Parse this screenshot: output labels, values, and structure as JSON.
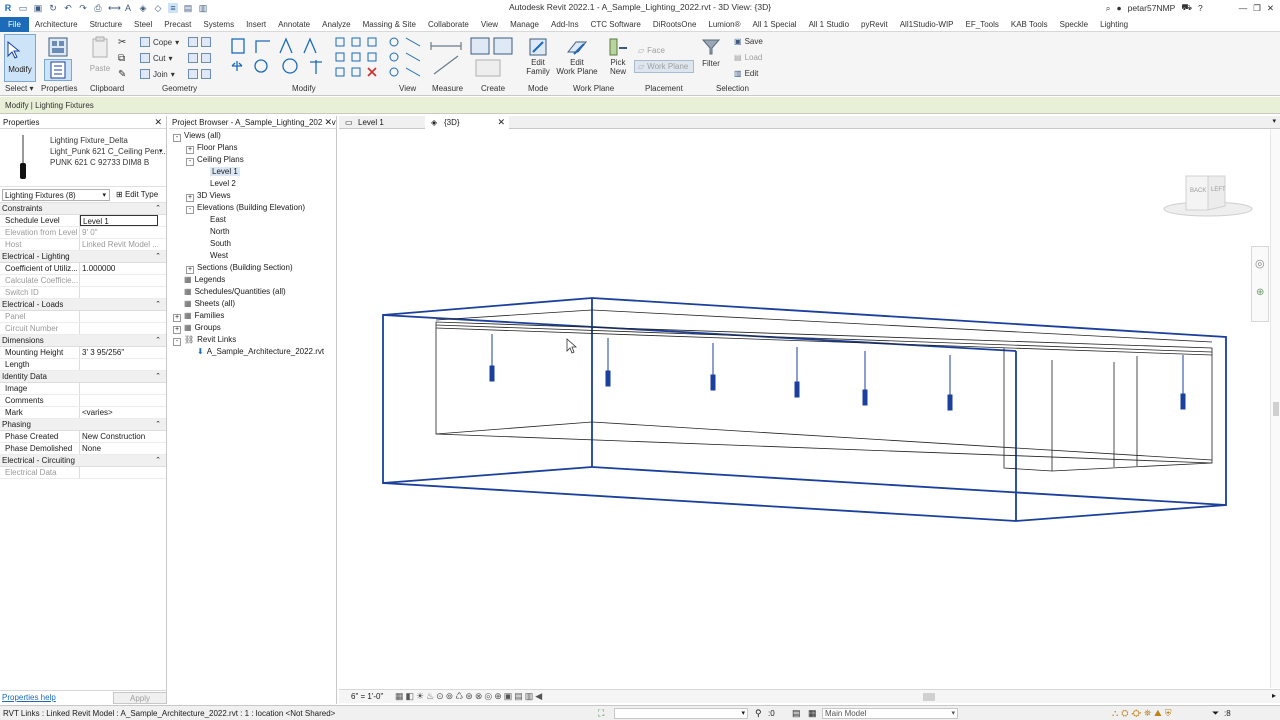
{
  "window": {
    "title": "Autodesk Revit 2022.1 - A_Sample_Lighting_2022.rvt - 3D View: {3D}",
    "user": "petar57NMP"
  },
  "ribbon_tabs": [
    "File",
    "Architecture",
    "Structure",
    "Steel",
    "Precast",
    "Systems",
    "Insert",
    "Annotate",
    "Analyze",
    "Massing & Site",
    "Collaborate",
    "View",
    "Manage",
    "Add-Ins",
    "CTC Software",
    "DiRootsOne",
    "Lumion®",
    "All 1 Special",
    "All 1 Studio",
    "pyRevit",
    "All1Studio-WIP",
    "EF_Tools",
    "KAB Tools",
    "Speckle",
    "Lighting"
  ],
  "ribbon": {
    "modify": "Modify",
    "paste": "Paste",
    "cope": "Cope",
    "cut": "Cut",
    "join": "Join",
    "edit_family": [
      "Edit",
      "Family"
    ],
    "edit_work_plane": [
      "Edit",
      "Work Plane"
    ],
    "pick_new": [
      "Pick",
      "New"
    ],
    "face": "Face",
    "work_plane": "Work Plane",
    "filter": "Filter",
    "save": "Save",
    "load": "Load",
    "edit": "Edit",
    "panels": {
      "select": "Select",
      "properties": "Properties",
      "clipboard": "Clipboard",
      "geometry": "Geometry",
      "modify": "Modify",
      "view": "View",
      "measure": "Measure",
      "create": "Create",
      "mode": "Mode",
      "work_plane": "Work Plane",
      "placement": "Placement",
      "selection": "Selection"
    }
  },
  "context_bar": "Modify | Lighting Fixtures",
  "properties": {
    "title": "Properties",
    "type_family": "Lighting Fixture_Delta",
    "type_name_1": "Light_Punk 621 C_Ceiling Pen...",
    "type_name_2": "PUNK 621 C 92733 DIM8 B",
    "filter": "Lighting Fixtures (8)",
    "edit_type": "Edit Type",
    "groups": [
      {
        "name": "Constraints",
        "rows": [
          {
            "k": "Schedule Level",
            "v": "Level 1",
            "grey": false
          },
          {
            "k": "Elevation from Level",
            "v": "9'  0\"",
            "grey": true
          },
          {
            "k": "Host",
            "v": "Linked Revit Model ...",
            "grey": true
          }
        ]
      },
      {
        "name": "Electrical - Lighting",
        "rows": [
          {
            "k": "Coefficient of Utiliz...",
            "v": "1.000000",
            "grey": false
          },
          {
            "k": "Calculate Coefficie...",
            "v": "",
            "grey": true
          },
          {
            "k": "Switch ID",
            "v": "",
            "grey": true
          }
        ]
      },
      {
        "name": "Electrical - Loads",
        "rows": [
          {
            "k": "Panel",
            "v": "",
            "grey": true
          },
          {
            "k": "Circuit Number",
            "v": "",
            "grey": true
          }
        ]
      },
      {
        "name": "Dimensions",
        "rows": [
          {
            "k": "Mounting Height",
            "v": "3'  3 95/256\"",
            "grey": false
          },
          {
            "k": "Length",
            "v": "",
            "grey": false
          }
        ]
      },
      {
        "name": "Identity Data",
        "rows": [
          {
            "k": "Image",
            "v": "",
            "grey": false
          },
          {
            "k": "Comments",
            "v": "",
            "grey": false
          },
          {
            "k": "Mark",
            "v": "<varies>",
            "grey": false
          }
        ]
      },
      {
        "name": "Phasing",
        "rows": [
          {
            "k": "Phase Created",
            "v": "New Construction",
            "grey": false
          },
          {
            "k": "Phase Demolished",
            "v": "None",
            "grey": false
          }
        ]
      },
      {
        "name": "Electrical - Circuiting",
        "rows": [
          {
            "k": "Electrical Data",
            "v": "",
            "grey": true
          }
        ]
      }
    ],
    "help": "Properties help",
    "apply": "Apply"
  },
  "browser": {
    "title": "Project Browser - A_Sample_Lighting_2022.rvt",
    "nodes": [
      {
        "label": "Views (all)",
        "indent": 0,
        "toggle": "-"
      },
      {
        "label": "Floor Plans",
        "indent": 1,
        "toggle": "+"
      },
      {
        "label": "Ceiling Plans",
        "indent": 1,
        "toggle": "-"
      },
      {
        "label": "Level 1",
        "indent": 2,
        "toggle": "",
        "selected": true
      },
      {
        "label": "Level 2",
        "indent": 2,
        "toggle": ""
      },
      {
        "label": "3D Views",
        "indent": 1,
        "toggle": "+"
      },
      {
        "label": "Elevations (Building Elevation)",
        "indent": 1,
        "toggle": "-"
      },
      {
        "label": "East",
        "indent": 2,
        "toggle": ""
      },
      {
        "label": "North",
        "indent": 2,
        "toggle": ""
      },
      {
        "label": "South",
        "indent": 2,
        "toggle": ""
      },
      {
        "label": "West",
        "indent": 2,
        "toggle": ""
      },
      {
        "label": "Sections (Building Section)",
        "indent": 1,
        "toggle": "+"
      },
      {
        "label": "Legends",
        "indent": 0,
        "toggle": "",
        "icon": true
      },
      {
        "label": "Schedules/Quantities (all)",
        "indent": 0,
        "toggle": "",
        "icon": true
      },
      {
        "label": "Sheets (all)",
        "indent": 0,
        "toggle": "",
        "icon": true
      },
      {
        "label": "Families",
        "indent": 0,
        "toggle": "+",
        "icon": true
      },
      {
        "label": "Groups",
        "indent": 0,
        "toggle": "+",
        "icon": true
      },
      {
        "label": "Revit Links",
        "indent": 0,
        "toggle": "-",
        "icon": true
      },
      {
        "label": "A_Sample_Architecture_2022.rvt",
        "indent": 1,
        "toggle": "",
        "icon": true
      }
    ]
  },
  "view_tabs": [
    {
      "label": "Level 1",
      "active": false
    },
    {
      "label": "{3D}",
      "active": true
    }
  ],
  "viewcube": {
    "back": "BACK",
    "left": "LEFT"
  },
  "view_controls": {
    "scale": "6\" = 1'-0\""
  },
  "status": {
    "message": "RVT Links : Linked Revit Model : A_Sample_Architecture_2022.rvt : 1 : location <Not Shared>",
    "coord": ":0",
    "model": "Main Model",
    "filter": ":8"
  },
  "colors": {
    "accent": "#1c6bb8",
    "context_bar": "#e8f0d8",
    "selection_blue": "#1a3f9c"
  }
}
